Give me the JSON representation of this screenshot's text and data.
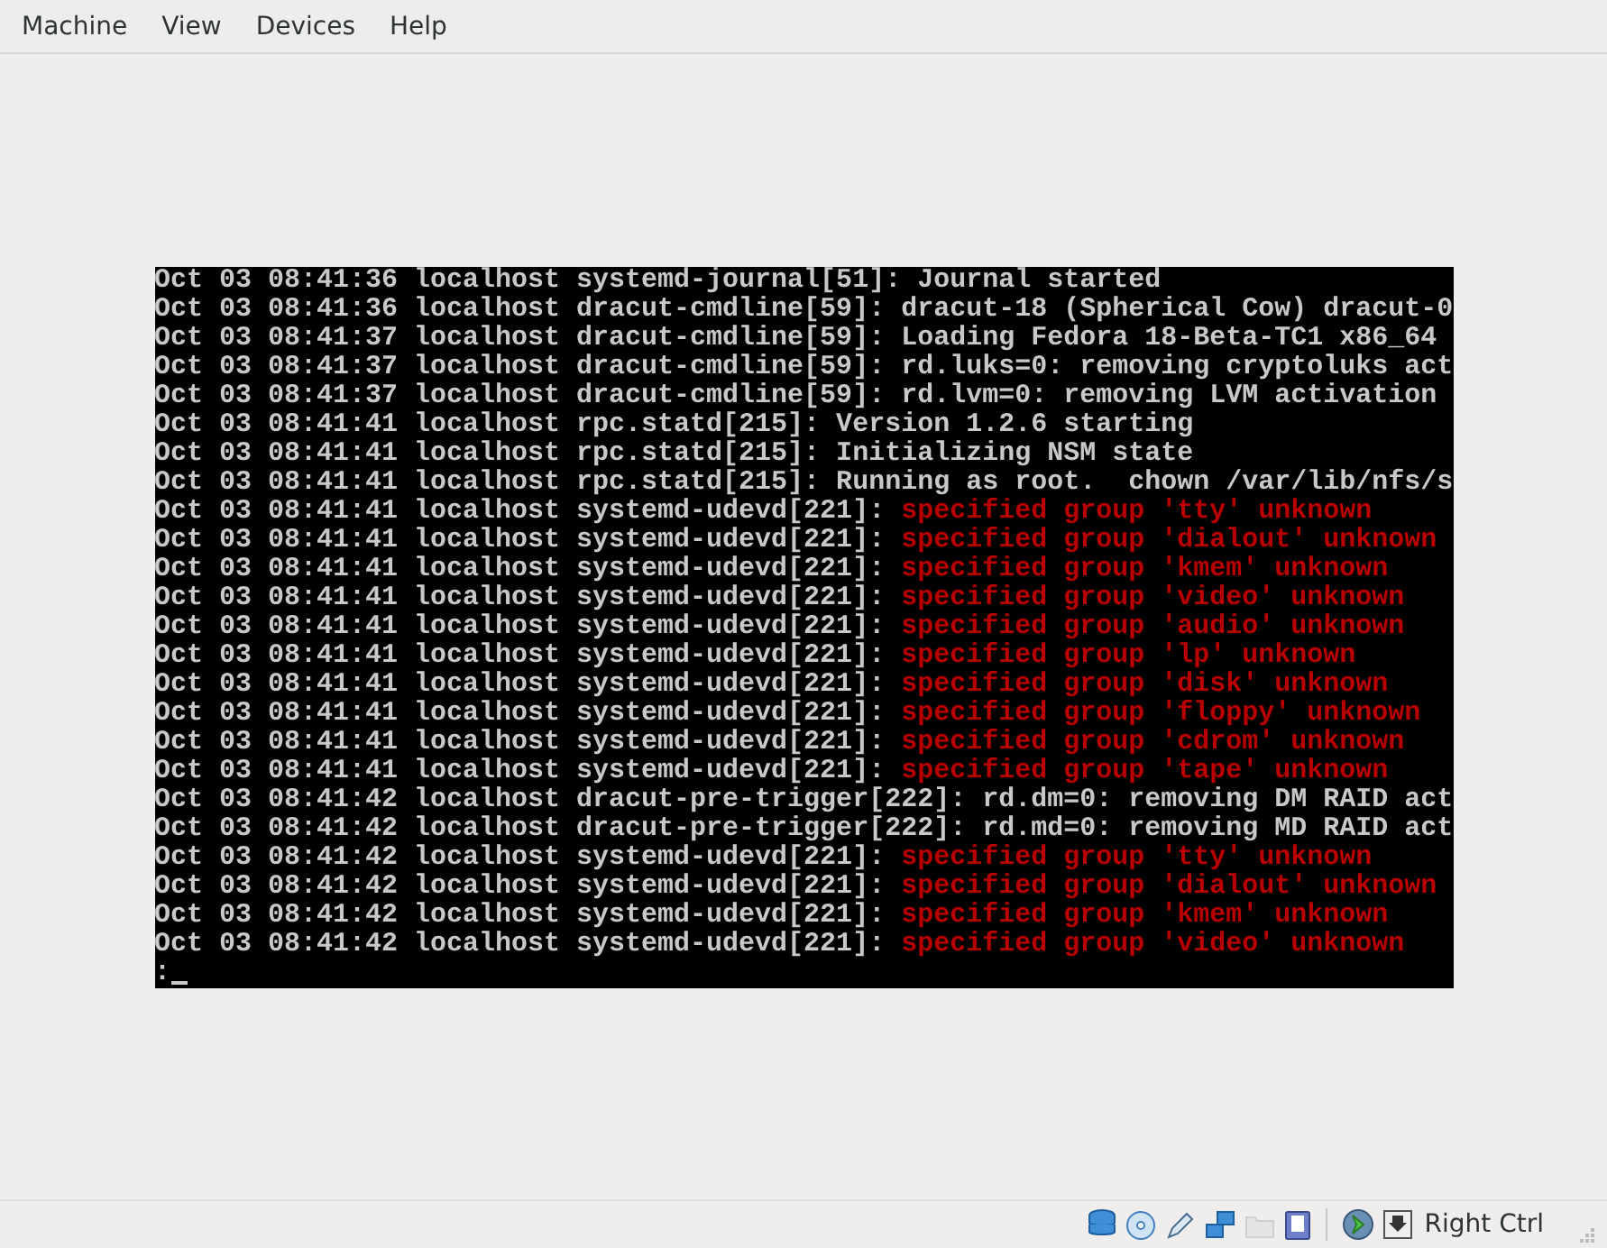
{
  "menu": [
    "Machine",
    "View",
    "Devices",
    "Help"
  ],
  "console": {
    "lines": [
      {
        "kind": "info",
        "text": "Oct 03 08:41:36 localhost systemd-journal[51]: Journal started"
      },
      {
        "kind": "info",
        "text": "Oct 03 08:41:36 localhost dracut-cmdline[59]: dracut-18 (Spherical Cow) dracut-0"
      },
      {
        "kind": "info",
        "text": "Oct 03 08:41:37 localhost dracut-cmdline[59]: Loading Fedora 18-Beta-TC1 x86_64"
      },
      {
        "kind": "info",
        "text": "Oct 03 08:41:37 localhost dracut-cmdline[59]: rd.luks=0: removing cryptoluks act"
      },
      {
        "kind": "info",
        "text": "Oct 03 08:41:37 localhost dracut-cmdline[59]: rd.lvm=0: removing LVM activation"
      },
      {
        "kind": "info",
        "text": "Oct 03 08:41:41 localhost rpc.statd[215]: Version 1.2.6 starting"
      },
      {
        "kind": "info",
        "text": "Oct 03 08:41:41 localhost rpc.statd[215]: Initializing NSM state"
      },
      {
        "kind": "info",
        "text": "Oct 03 08:41:41 localhost rpc.statd[215]: Running as root.  chown /var/lib/nfs/s"
      },
      {
        "kind": "error",
        "text": "Oct 03 08:41:41 localhost systemd-udevd[221]:",
        "message": "specified group 'tty' unknown"
      },
      {
        "kind": "error",
        "text": "Oct 03 08:41:41 localhost systemd-udevd[221]:",
        "message": "specified group 'dialout' unknown"
      },
      {
        "kind": "error",
        "text": "Oct 03 08:41:41 localhost systemd-udevd[221]:",
        "message": "specified group 'kmem' unknown"
      },
      {
        "kind": "error",
        "text": "Oct 03 08:41:41 localhost systemd-udevd[221]:",
        "message": "specified group 'video' unknown"
      },
      {
        "kind": "error",
        "text": "Oct 03 08:41:41 localhost systemd-udevd[221]:",
        "message": "specified group 'audio' unknown"
      },
      {
        "kind": "error",
        "text": "Oct 03 08:41:41 localhost systemd-udevd[221]:",
        "message": "specified group 'lp' unknown"
      },
      {
        "kind": "error",
        "text": "Oct 03 08:41:41 localhost systemd-udevd[221]:",
        "message": "specified group 'disk' unknown"
      },
      {
        "kind": "error",
        "text": "Oct 03 08:41:41 localhost systemd-udevd[221]:",
        "message": "specified group 'floppy' unknown"
      },
      {
        "kind": "error",
        "text": "Oct 03 08:41:41 localhost systemd-udevd[221]:",
        "message": "specified group 'cdrom' unknown"
      },
      {
        "kind": "error",
        "text": "Oct 03 08:41:41 localhost systemd-udevd[221]:",
        "message": "specified group 'tape' unknown"
      },
      {
        "kind": "info",
        "text": "Oct 03 08:41:42 localhost dracut-pre-trigger[222]: rd.dm=0: removing DM RAID act"
      },
      {
        "kind": "info",
        "text": "Oct 03 08:41:42 localhost dracut-pre-trigger[222]: rd.md=0: removing MD RAID act"
      },
      {
        "kind": "error",
        "text": "Oct 03 08:41:42 localhost systemd-udevd[221]:",
        "message": "specified group 'tty' unknown"
      },
      {
        "kind": "error",
        "text": "Oct 03 08:41:42 localhost systemd-udevd[221]:",
        "message": "specified group 'dialout' unknown"
      },
      {
        "kind": "error",
        "text": "Oct 03 08:41:42 localhost systemd-udevd[221]:",
        "message": "specified group 'kmem' unknown"
      },
      {
        "kind": "error",
        "text": "Oct 03 08:41:42 localhost systemd-udevd[221]:",
        "message": "specified group 'video' unknown"
      }
    ],
    "prompt": ":"
  },
  "status_bar": {
    "host_key": "Right Ctrl",
    "shared_folders_disabled": true
  }
}
